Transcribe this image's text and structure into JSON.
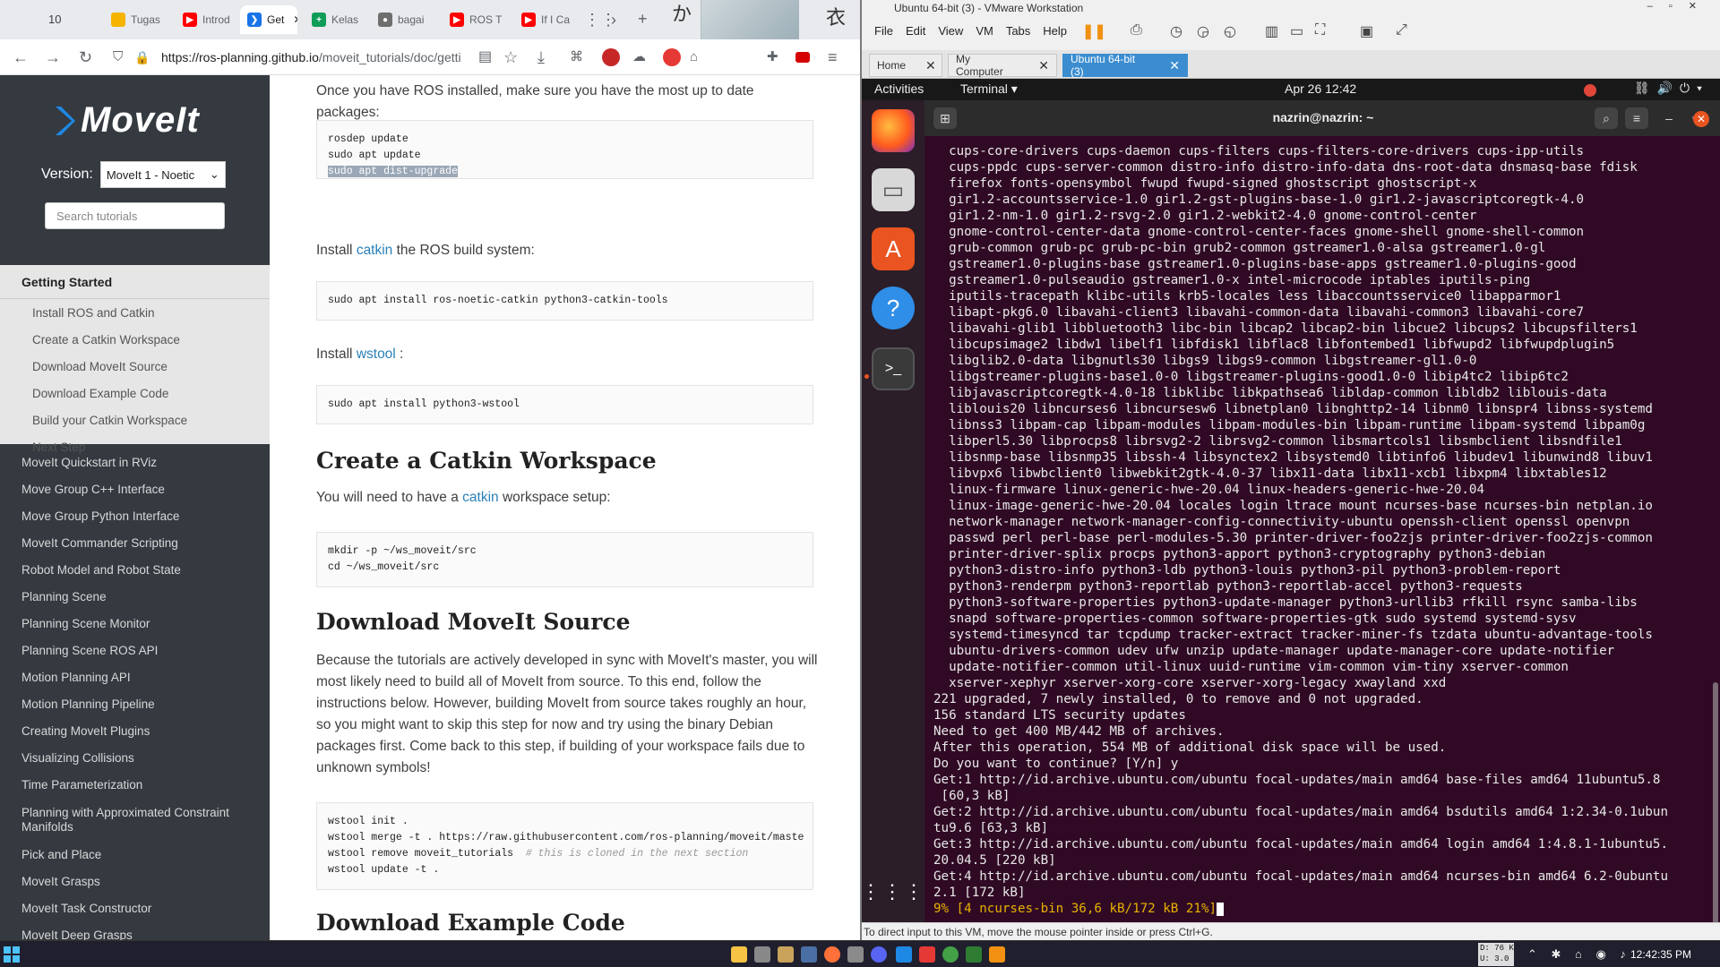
{
  "browser": {
    "tab_count": "10",
    "tabs": [
      {
        "label": "Tugas",
        "color": "#f4b400",
        "glyph": ""
      },
      {
        "label": "Introd",
        "color": "#ff0000",
        "glyph": "▶"
      },
      {
        "label": "Get",
        "color": "#1a73e8",
        "glyph": "❯",
        "active": true
      },
      {
        "label": "Kelas",
        "color": "#0f9d58",
        "glyph": "+"
      },
      {
        "label": "bagai",
        "color": "#6e6e6e",
        "glyph": "●"
      },
      {
        "label": "ROS T",
        "color": "#ff0000",
        "glyph": "▶"
      },
      {
        "label": "If I Ca",
        "color": "#ff0000",
        "glyph": "▶"
      }
    ],
    "url_host": "https://ros-planning.github.io",
    "url_path": "/moveit_tutorials/doc/getti"
  },
  "sidebar": {
    "logo_text": "MoveIt",
    "version_label": "Version:",
    "version_value": "MoveIt 1 - Noetic",
    "search_placeholder": "Search tutorials",
    "section_title": "Getting Started",
    "section_items": [
      "Install ROS and Catkin",
      "Create a Catkin Workspace",
      "Download MoveIt Source",
      "Download Example Code",
      "Build your Catkin Workspace",
      "Next Step"
    ],
    "nav_items": [
      "MoveIt Quickstart in RViz",
      "Move Group C++ Interface",
      "Move Group Python Interface",
      "MoveIt Commander Scripting",
      "Robot Model and Robot State",
      "Planning Scene",
      "Planning Scene Monitor",
      "Planning Scene ROS API",
      "Motion Planning API",
      "Motion Planning Pipeline",
      "Creating MoveIt Plugins",
      "Visualizing Collisions",
      "Time Parameterization",
      "Planning with Approximated Constraint Manifolds",
      "Pick and Place",
      "MoveIt Grasps",
      "MoveIt Task Constructor",
      "MoveIt Deep Grasps"
    ]
  },
  "content": {
    "intro": "Once you have ROS installed, make sure you have the most up to date packages:",
    "code1": [
      "rosdep update",
      "sudo apt update",
      "sudo apt dist-upgrade"
    ],
    "catkin_pre": "Install ",
    "catkin_link": "catkin",
    "catkin_post": " the ROS build system:",
    "code2": "sudo apt install ros-noetic-catkin python3-catkin-tools",
    "wstool_pre": "Install ",
    "wstool_link": "wstool",
    "wstool_post": " :",
    "code3": "sudo apt install python3-wstool",
    "h_workspace": "Create a Catkin Workspace",
    "ws_pre": "You will need to have a ",
    "ws_link": "catkin",
    "ws_post": " workspace setup:",
    "code4": [
      "mkdir -p ~/ws_moveit/src",
      "cd ~/ws_moveit/src"
    ],
    "h_source": "Download MoveIt Source",
    "source_para": "Because the tutorials are actively developed in sync with MoveIt's master, you will most likely need to build all of MoveIt from source. To this end, follow the instructions below. However, building MoveIt from source takes roughly an hour, so you might want to skip this step for now and try using the binary Debian packages first. Come back to this step, if building of your workspace fails due to unknown symbols!",
    "code5": [
      "wstool init .",
      "wstool merge -t . https://raw.githubusercontent.com/ros-planning/moveit/maste",
      "wstool remove moveit_tutorials  ",
      "wstool update -t ."
    ],
    "code5_comment": "# this is cloned in the next section",
    "h_example": "Download Example Code"
  },
  "vmware": {
    "title": "Ubuntu 64-bit (3) - VMware Workstation",
    "menu": [
      "File",
      "Edit",
      "View",
      "VM",
      "Tabs",
      "Help"
    ],
    "tabs": [
      "Home",
      "My Computer",
      "Ubuntu 64-bit (3)"
    ],
    "status": "To direct input to this VM, move the mouse pointer inside or press Ctrl+G."
  },
  "ubuntu": {
    "activities": "Activities",
    "app_menu": "Terminal ▾",
    "clock": "Apr 26  12:42",
    "terminal_title": "nazrin@nazrin: ~"
  },
  "terminal": {
    "lines": [
      "  cups-core-drivers cups-daemon cups-filters cups-filters-core-drivers cups-ipp-utils",
      "  cups-ppdc cups-server-common distro-info distro-info-data dns-root-data dnsmasq-base fdisk",
      "  firefox fonts-opensymbol fwupd fwupd-signed ghostscript ghostscript-x",
      "  gir1.2-accountsservice-1.0 gir1.2-gst-plugins-base-1.0 gir1.2-javascriptcoregtk-4.0",
      "  gir1.2-nm-1.0 gir1.2-rsvg-2.0 gir1.2-webkit2-4.0 gnome-control-center",
      "  gnome-control-center-data gnome-control-center-faces gnome-shell gnome-shell-common",
      "  grub-common grub-pc grub-pc-bin grub2-common gstreamer1.0-alsa gstreamer1.0-gl",
      "  gstreamer1.0-plugins-base gstreamer1.0-plugins-base-apps gstreamer1.0-plugins-good",
      "  gstreamer1.0-pulseaudio gstreamer1.0-x intel-microcode iptables iputils-ping",
      "  iputils-tracepath klibc-utils krb5-locales less libaccountsservice0 libapparmor1",
      "  libapt-pkg6.0 libavahi-client3 libavahi-common-data libavahi-common3 libavahi-core7",
      "  libavahi-glib1 libbluetooth3 libc-bin libcap2 libcap2-bin libcue2 libcups2 libcupsfilters1",
      "  libcupsimage2 libdw1 libelf1 libfdisk1 libflac8 libfontembed1 libfwupd2 libfwupdplugin5",
      "  libglib2.0-data libgnutls30 libgs9 libgs9-common libgstreamer-gl1.0-0",
      "  libgstreamer-plugins-base1.0-0 libgstreamer-plugins-good1.0-0 libip4tc2 libip6tc2",
      "  libjavascriptcoregtk-4.0-18 libklibc libkpathsea6 libldap-common libldb2 liblouis-data",
      "  liblouis20 libncurses6 libncursesw6 libnetplan0 libnghttp2-14 libnm0 libnspr4 libnss-systemd",
      "  libnss3 libpam-cap libpam-modules libpam-modules-bin libpam-runtime libpam-systemd libpam0g",
      "  libperl5.30 libprocps8 librsvg2-2 librsvg2-common libsmartcols1 libsmbclient libsndfile1",
      "  libsnmp-base libsnmp35 libssh-4 libsynctex2 libsystemd0 libtinfo6 libudev1 libunwind8 libuv1",
      "  libvpx6 libwbclient0 libwebkit2gtk-4.0-37 libx11-data libx11-xcb1 libxpm4 libxtables12",
      "  linux-firmware linux-generic-hwe-20.04 linux-headers-generic-hwe-20.04",
      "  linux-image-generic-hwe-20.04 locales login ltrace mount ncurses-base ncurses-bin netplan.io",
      "  network-manager network-manager-config-connectivity-ubuntu openssh-client openssl openvpn",
      "  passwd perl perl-base perl-modules-5.30 printer-driver-foo2zjs printer-driver-foo2zjs-common",
      "  printer-driver-splix procps python3-apport python3-cryptography python3-debian",
      "  python3-distro-info python3-ldb python3-louis python3-pil python3-problem-report",
      "  python3-renderpm python3-reportlab python3-reportlab-accel python3-requests",
      "  python3-software-properties python3-update-manager python3-urllib3 rfkill rsync samba-libs",
      "  snapd software-properties-common software-properties-gtk sudo systemd systemd-sysv",
      "  systemd-timesyncd tar tcpdump tracker-extract tracker-miner-fs tzdata ubuntu-advantage-tools",
      "  ubuntu-drivers-common udev ufw unzip update-manager update-manager-core update-notifier",
      "  update-notifier-common util-linux uuid-runtime vim-common vim-tiny xserver-common",
      "  xserver-xephyr xserver-xorg-core xserver-xorg-legacy xwayland xxd",
      "221 upgraded, 7 newly installed, 0 to remove and 0 not upgraded.",
      "156 standard LTS security updates",
      "Need to get 400 MB/442 MB of archives.",
      "After this operation, 554 MB of additional disk space will be used.",
      "Do you want to continue? [Y/n] y",
      "Get:1 http://id.archive.ubuntu.com/ubuntu focal-updates/main amd64 base-files amd64 11ubuntu5.8",
      " [60,3 kB]",
      "Get:2 http://id.archive.ubuntu.com/ubuntu focal-updates/main amd64 bsdutils amd64 1:2.34-0.1ubun",
      "tu9.6 [63,3 kB]",
      "Get:3 http://id.archive.ubuntu.com/ubuntu focal-updates/main amd64 login amd64 1:4.8.1-1ubuntu5.",
      "20.04.5 [220 kB]",
      "Get:4 http://id.archive.ubuntu.com/ubuntu focal-updates/main amd64 ncurses-bin amd64 6.2-0ubuntu",
      "2.1 [172 kB]"
    ],
    "progress": "9% [4 ncurses-bin 36,6 kB/172 kB 21%]"
  },
  "taskbar": {
    "net_down": "D: 76 K",
    "net_up": "U: 3.0 K",
    "time": "12:42:35 PM"
  }
}
